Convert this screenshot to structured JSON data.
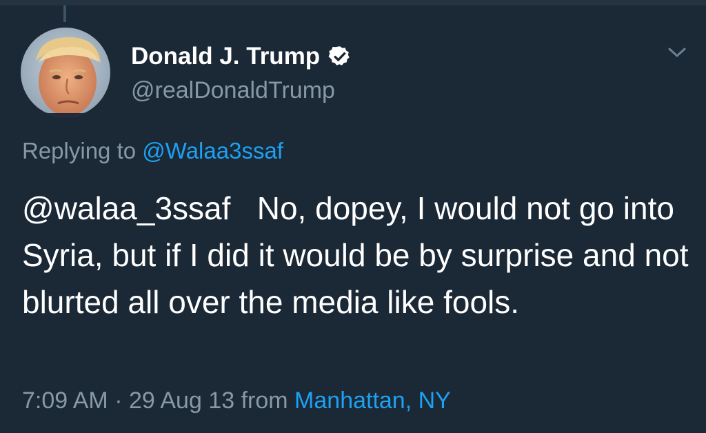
{
  "tweet": {
    "author": {
      "display_name": "Donald J. Trump",
      "handle": "@realDonaldTrump",
      "verified": true,
      "avatar_icon": "avatar-photo"
    },
    "reply": {
      "prefix": "Replying to",
      "mention": "@Walaa3ssaf"
    },
    "text": "@walaa_3ssaf   No, dopey, I would not go into Syria, but if I did it would be by surprise and not blurted all over the media like fools.",
    "meta": {
      "time": "7:09 AM",
      "separator": "·",
      "date": "29 Aug 13",
      "from_label": "from",
      "location": "Manhattan, NY"
    },
    "menu_icon": "chevron-down-icon"
  },
  "colors": {
    "background": "#1b2836",
    "primary_text": "#ffffff",
    "secondary_text": "#8899a6",
    "link": "#1da1f2"
  }
}
